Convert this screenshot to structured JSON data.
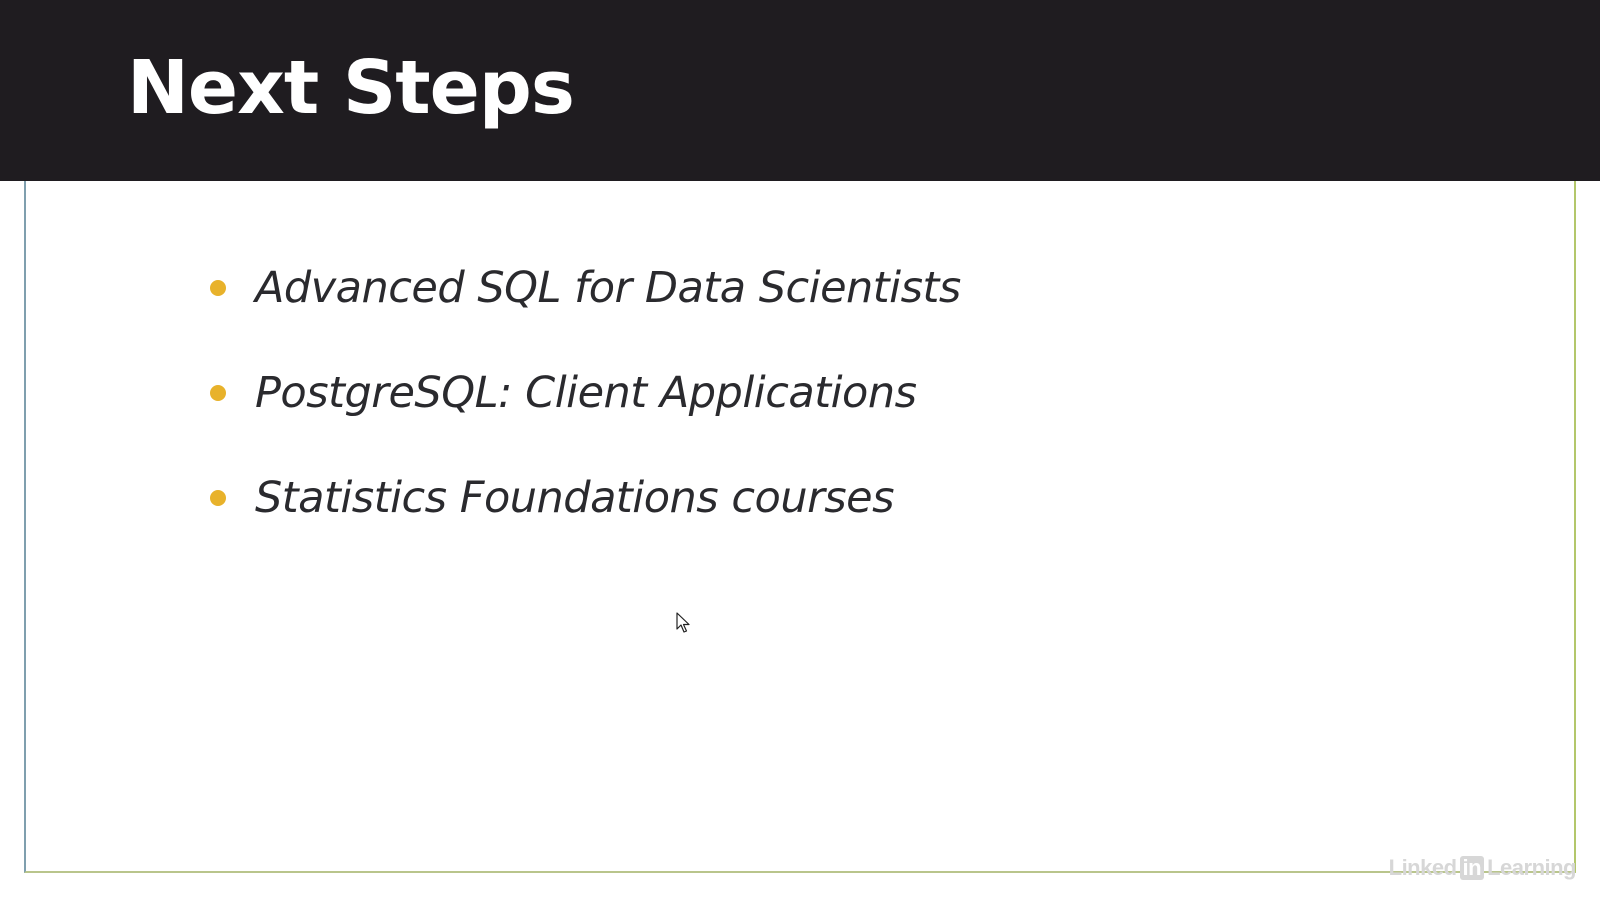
{
  "slide": {
    "title": "Next Steps",
    "bullets": [
      {
        "text": "Advanced SQL for Data Scientists"
      },
      {
        "text": "PostgreSQL: Client Applications"
      },
      {
        "text": "Statistics Foundations courses"
      }
    ]
  },
  "watermark": {
    "prefix": "Linked",
    "boxed": "in",
    "suffix": "Learning"
  },
  "colors": {
    "title_bar": "#1f1c20",
    "bullet": "#e8b22b",
    "body_text": "#2a2a2e",
    "frame_left": "#7f9fae",
    "frame_right": "#b3c76b"
  },
  "icons": {
    "cursor": "mouse-pointer-icon",
    "bullet": "dot-icon"
  }
}
